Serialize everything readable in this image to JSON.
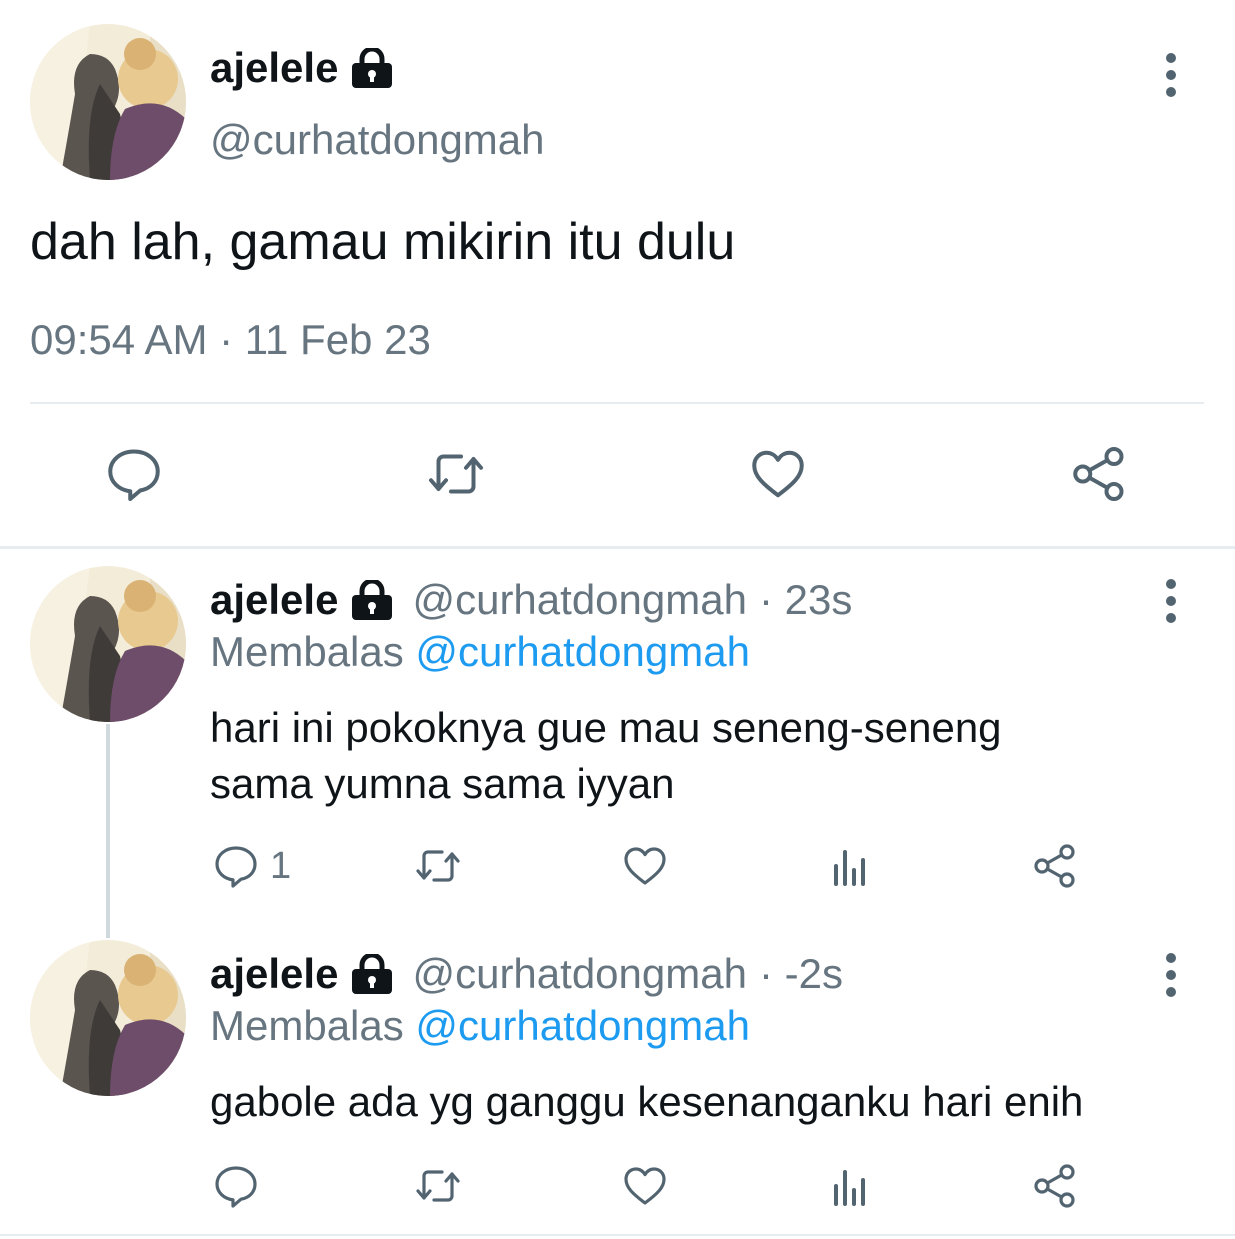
{
  "main_tweet": {
    "display_name": "ajelele",
    "handle": "@curhatdongmah",
    "text": "dah lah, gamau mikirin itu dulu",
    "timestamp": "09:54 AM · 11 Feb 23",
    "icons": [
      "lock-icon",
      "more-icon",
      "reply-icon",
      "retweet-icon",
      "like-icon",
      "share-icon"
    ]
  },
  "replies": [
    {
      "display_name": "ajelele",
      "handle": "@curhatdongmah",
      "time": "· 23s",
      "replying_label": "Membalas",
      "replying_to": "@curhatdongmah",
      "text_line1": "hari ini pokoknya gue mau seneng-seneng",
      "text_line2": "sama yumna sama iyyan",
      "reply_count": "1"
    },
    {
      "display_name": "ajelele",
      "handle": "@curhatdongmah",
      "time": "· -2s",
      "replying_label": "Membalas",
      "replying_to": "@curhatdongmah",
      "text_line1": "gabole ada yg ganggu kesenanganku hari enih",
      "reply_count": ""
    }
  ],
  "colors": {
    "text": "#0f1419",
    "secondary": "#66757f",
    "link": "#1d9bf0",
    "divider": "#e6ecf0"
  }
}
